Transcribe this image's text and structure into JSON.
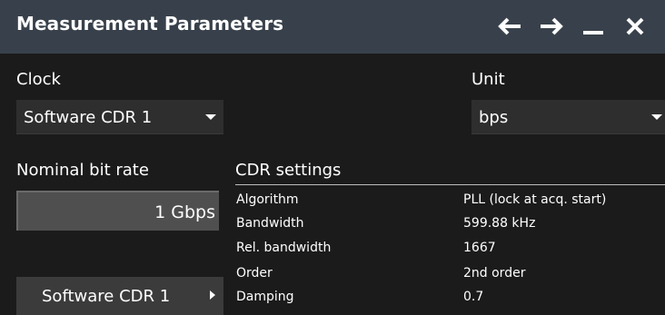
{
  "window": {
    "title": "Measurement Parameters",
    "buttons": [
      "back-arrow-icon",
      "forward-arrow-icon",
      "minimize-icon",
      "close-icon"
    ]
  },
  "clock": {
    "label": "Clock",
    "selected": "Software CDR 1"
  },
  "unit": {
    "label": "Unit",
    "selected": "bps"
  },
  "nominal_bit_rate": {
    "label": "Nominal bit rate",
    "value": "1 Gbps"
  },
  "cdr_settings": {
    "title": "CDR settings",
    "rows": [
      {
        "key": "Algorithm",
        "value": "PLL (lock at acq. start)"
      },
      {
        "key": "Bandwidth",
        "value": "599.88 kHz"
      },
      {
        "key": "Rel. bandwidth",
        "value": "1667"
      },
      {
        "key": "Order",
        "value": "2nd order"
      },
      {
        "key": "Damping",
        "value": "0.7"
      }
    ]
  },
  "cdr_button": {
    "label": "Software CDR 1"
  },
  "colors": {
    "titlebar": "#38414b",
    "background": "#1b1b1b",
    "dropdown": "#2e2e2e",
    "numfield": "#4f4f4f"
  }
}
